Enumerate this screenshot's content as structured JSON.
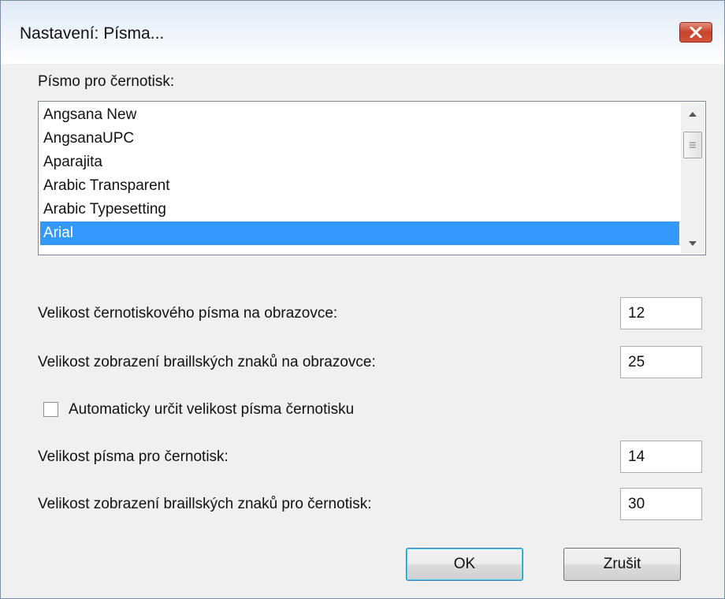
{
  "window": {
    "title": "Nastavení: Písma..."
  },
  "font_list": {
    "label": "Písmo pro černotisk:",
    "items": [
      {
        "label": "Angsana New",
        "selected": false
      },
      {
        "label": "AngsanaUPC",
        "selected": false
      },
      {
        "label": "Aparajita",
        "selected": false
      },
      {
        "label": "Arabic Transparent",
        "selected": false
      },
      {
        "label": "Arabic Typesetting",
        "selected": false
      },
      {
        "label": "Arial",
        "selected": true
      }
    ]
  },
  "fields": {
    "screen_print_size": {
      "label": "Velikost černotiskového písma na obrazovce:",
      "value": "12"
    },
    "screen_braille_size": {
      "label": "Velikost zobrazení braillských znaků na obrazovce:",
      "value": "25"
    },
    "auto_size": {
      "label": "Automaticky určit velikost písma černotisku",
      "checked": false
    },
    "print_font_size": {
      "label": "Velikost písma pro černotisk:",
      "value": "14"
    },
    "print_braille_size": {
      "label": "Velikost zobrazení braillských znaků pro černotisk:",
      "value": "30"
    }
  },
  "buttons": {
    "ok": "OK",
    "cancel": "Zrušit"
  },
  "icons": {
    "close": "close-icon",
    "scroll_up": "chevron-up-icon",
    "scroll_down": "chevron-down-icon",
    "scroll_grip": "grip-icon"
  },
  "colors": {
    "selection": "#3399ff",
    "close_button": "#c7432b"
  }
}
